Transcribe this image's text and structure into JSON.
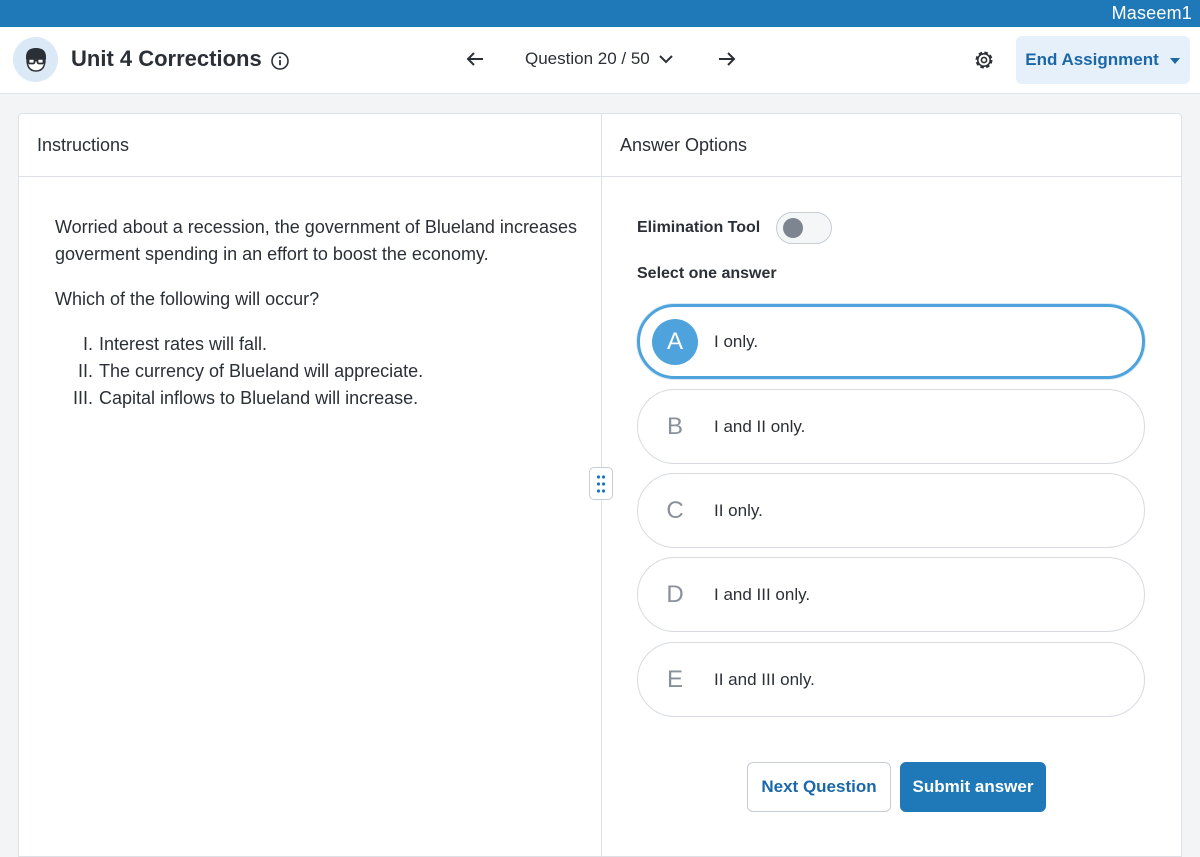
{
  "topbar": {
    "username": "Maseem1"
  },
  "header": {
    "title": "Unit 4 Corrections",
    "question_selector": "Question 20 / 50",
    "end_button": "End Assignment"
  },
  "instructions": {
    "heading": "Instructions",
    "paragraph1": "Worried about a recession, the government of Blueland increases goverment spending in an effort to boost the economy.",
    "paragraph2": "Which of the following will occur?",
    "statements": [
      {
        "num": "I.",
        "text": "Interest rates will fall."
      },
      {
        "num": "II.",
        "text": "The currency of Blueland will appreciate."
      },
      {
        "num": "III.",
        "text": "Capital inflows to Blueland will increase."
      }
    ]
  },
  "answers": {
    "heading": "Answer Options",
    "elimination_label": "Elimination Tool",
    "elimination_enabled": false,
    "select_label": "Select one answer",
    "selected": "A",
    "options": [
      {
        "letter": "A",
        "text": "I only."
      },
      {
        "letter": "B",
        "text": "I and II only."
      },
      {
        "letter": "C",
        "text": "II only."
      },
      {
        "letter": "D",
        "text": "I and III only."
      },
      {
        "letter": "E",
        "text": "II and III only."
      }
    ],
    "next_button": "Next Question",
    "submit_button": "Submit answer"
  },
  "colors": {
    "brand": "#1f78b8",
    "selected_accent": "#4fa3dc",
    "end_button_bg": "#e6f0fa"
  },
  "icons": {
    "avatar": "avatar-glasses-icon",
    "info": "info-icon",
    "back": "arrow-left-icon",
    "dropdown": "chevron-down-icon",
    "forward": "arrow-right-icon",
    "settings": "gear-icon",
    "end_caret": "caret-down-icon",
    "resize": "drag-handle-icon"
  }
}
